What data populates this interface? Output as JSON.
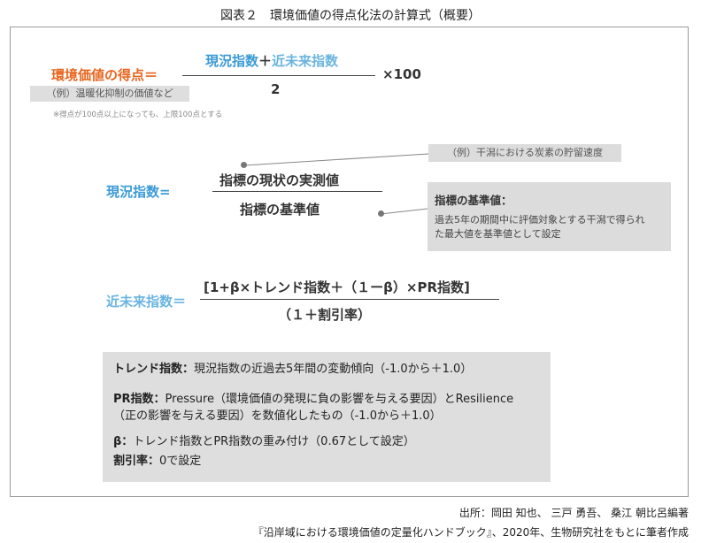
{
  "title": "図表２　環境価値の得点化法の計算式（概要）",
  "formula1": {
    "lhs": "環境価値の得点＝",
    "num_a": "現況指数",
    "num_plus": "＋",
    "num_b": "近未来指数",
    "den": "2",
    "mult": "×100",
    "example": "（例）温暖化抑制の価値など",
    "note": "※得点が100点以上になっても、上限100点とする"
  },
  "formula2": {
    "lhs": "現況指数=",
    "num": "指標の現状の実測値",
    "den": "指標の基準値",
    "callout_example": "（例）干潟における炭素の貯留速度",
    "callout_title": "指標の基準値：",
    "callout_text1": "過去5年の期間中に評価対象とする干潟で得られ",
    "callout_text2": "た最大値を基準値として設定"
  },
  "formula3": {
    "lhs": "近未来指数＝",
    "num": "[1+β×トレンド指数＋（１ーβ）×PR指数]",
    "den": "（１＋割引率）"
  },
  "legend": {
    "trend_label": "トレンド指数：",
    "trend_text": "現況指数の近過去5年間の変動傾向（-1.0から＋1.0）",
    "pr_label": "PR指数：",
    "pr_text1": "Pressure（環境価値の発現に負の影響を与える要因）とResilience",
    "pr_text2": "（正の影響を与える要因）を数値化したもの（-1.0から＋1.0）",
    "beta_label": "β：",
    "beta_text": "トレンド指数とPR指数の重み付け（0.67として設定）",
    "discount_label": "割引率：",
    "discount_text": "0で設定"
  },
  "source": {
    "line1": "出所：岡田 知也、 三戸 勇吾、 桑江 朝比呂編著",
    "line2": "『沿岸域における環境価値の定量化ハンドブック』、2020年、生物研究社をもとに筆者作成"
  }
}
